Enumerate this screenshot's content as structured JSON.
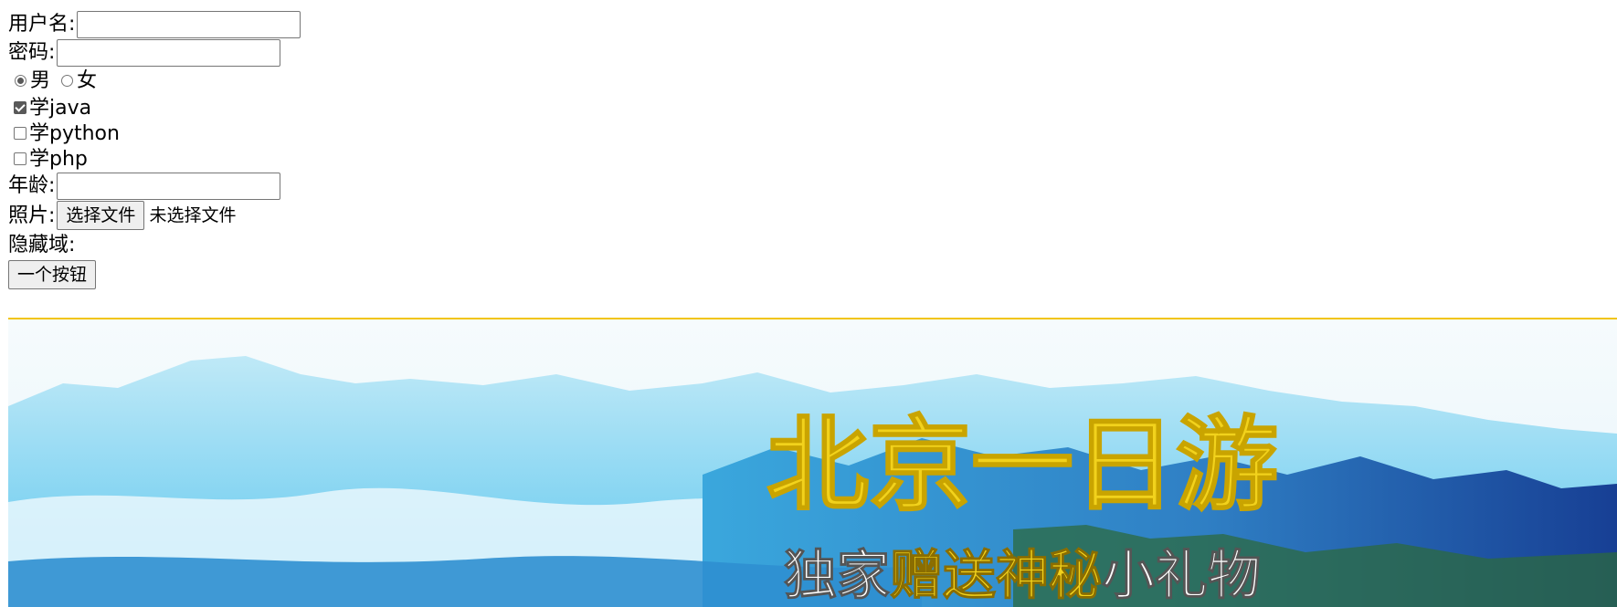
{
  "form": {
    "username_label": "用户名:",
    "username_value": "",
    "password_label": "密码:",
    "password_value": "",
    "gender": {
      "options": [
        {
          "label": "男",
          "checked": true
        },
        {
          "label": "女",
          "checked": false
        }
      ]
    },
    "hobbies": [
      {
        "label": "学java",
        "checked": true
      },
      {
        "label": "学python",
        "checked": false
      },
      {
        "label": "学php",
        "checked": false
      }
    ],
    "age_label": "年龄:",
    "age_value": "",
    "photo_label": "照片:",
    "file_button_label": "选择文件",
    "file_status": "未选择文件",
    "hidden_label": "隐藏域:",
    "button_label": "一个按钮"
  },
  "banner": {
    "title": "北京一日游",
    "subtitle_part1": "独家",
    "subtitle_part2": "赠送神秘",
    "subtitle_part3": "小礼物",
    "colors": {
      "title": "#f2d21c",
      "subtitle_white": "#ffffff",
      "subtitle_yellow": "#f2d21c",
      "sky": "#eef7fb",
      "mountain_light": "#8fd6ef",
      "mountain_mid": "#45b6e6",
      "mountain_dark": "#1c4fa3",
      "border": "#f1c40f"
    }
  }
}
